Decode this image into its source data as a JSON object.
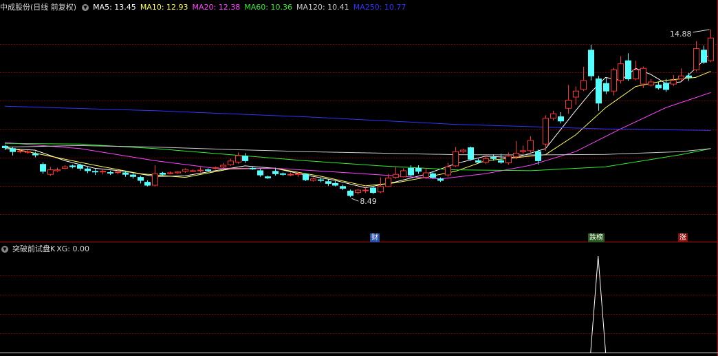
{
  "header": {
    "stock_title": "中成股份(日线 前复权)",
    "ma_items": [
      {
        "label": "MA5: 13.45",
        "color": "#ffffff"
      },
      {
        "label": "MA10: 12.93",
        "color": "#ffff55"
      },
      {
        "label": "MA20: 12.38",
        "color": "#ff44ff"
      },
      {
        "label": "MA60: 10.36",
        "color": "#33ee33"
      },
      {
        "label": "MA120: 10.41",
        "color": "#cccccc"
      },
      {
        "label": "MA250: 10.77",
        "color": "#3333ff"
      }
    ]
  },
  "indicator": {
    "title": "突破前试盘K",
    "value_label": "XG: 0.00"
  },
  "colors": {
    "up": "#ff3232",
    "down": "#54ffff",
    "grid": "#7a0000",
    "ma5": "#ffffff",
    "ma10": "#ffff55",
    "ma20": "#ff44ff",
    "ma60": "#33ee33",
    "ma120": "#cccccc",
    "ma250": "#3333ff"
  },
  "chart_data": {
    "type": "candlestick",
    "ylim": [
      7.9,
      15.4
    ],
    "max_label": "14.88",
    "min_label": "8.49",
    "candles": [
      [
        11.03,
        10.98,
        11.08,
        10.9
      ],
      [
        10.95,
        10.85,
        11.0,
        10.72
      ],
      [
        10.85,
        10.87,
        10.92,
        10.8
      ],
      [
        10.84,
        10.85,
        10.9,
        10.78
      ],
      [
        10.78,
        10.74,
        10.85,
        10.66
      ],
      [
        10.43,
        10.2,
        10.5,
        10.12
      ],
      [
        10.1,
        10.25,
        10.35,
        10.05
      ],
      [
        10.22,
        10.25,
        10.32,
        10.18
      ],
      [
        10.3,
        10.35,
        10.4,
        10.27
      ],
      [
        10.38,
        10.35,
        10.42,
        10.3
      ],
      [
        10.4,
        10.3,
        10.45,
        10.22
      ],
      [
        10.28,
        10.22,
        10.34,
        10.14
      ],
      [
        10.2,
        10.18,
        10.28,
        10.08
      ],
      [
        10.2,
        10.2,
        10.25,
        10.1
      ],
      [
        10.16,
        10.15,
        10.22,
        10.08
      ],
      [
        10.18,
        10.18,
        10.24,
        10.1
      ],
      [
        10.15,
        10.1,
        10.22,
        10.02
      ],
      [
        10.08,
        10.03,
        10.14,
        9.96
      ],
      [
        10.0,
        9.9,
        10.05,
        9.8
      ],
      [
        9.84,
        9.74,
        9.9,
        9.7
      ],
      [
        9.74,
        10.12,
        10.4,
        9.7
      ],
      [
        10.14,
        10.1,
        10.18,
        10.04
      ],
      [
        10.15,
        10.15,
        10.2,
        10.1
      ],
      [
        10.15,
        10.18,
        10.2,
        10.12
      ],
      [
        10.2,
        10.26,
        10.3,
        10.15
      ],
      [
        10.22,
        10.22,
        10.26,
        10.18
      ],
      [
        10.24,
        10.24,
        10.34,
        10.16
      ],
      [
        10.25,
        10.24,
        10.3,
        10.2
      ],
      [
        10.3,
        10.32,
        10.36,
        10.26
      ],
      [
        10.35,
        10.4,
        10.48,
        10.3
      ],
      [
        10.42,
        10.54,
        10.62,
        10.38
      ],
      [
        10.5,
        10.72,
        10.82,
        10.45
      ],
      [
        10.7,
        10.55,
        10.8,
        10.48
      ],
      [
        10.3,
        10.28,
        10.34,
        10.25
      ],
      [
        10.22,
        10.08,
        10.28,
        10.02
      ],
      [
        10.02,
        9.98,
        10.06,
        9.95
      ],
      [
        10.2,
        10.12,
        10.32,
        10.06
      ],
      [
        10.12,
        10.1,
        10.16,
        10.05
      ],
      [
        10.1,
        10.1,
        10.16,
        10.04
      ],
      [
        10.1,
        10.12,
        10.18,
        10.02
      ],
      [
        10.1,
        9.92,
        10.14,
        9.88
      ],
      [
        9.9,
        9.95,
        10.0,
        9.86
      ],
      [
        9.92,
        9.9,
        9.98,
        9.84
      ],
      [
        9.86,
        9.8,
        9.94,
        9.72
      ],
      [
        9.8,
        9.74,
        9.88,
        9.7
      ],
      [
        9.7,
        9.64,
        9.76,
        9.58
      ],
      [
        9.55,
        9.4,
        9.6,
        9.35
      ],
      [
        9.5,
        9.58,
        9.62,
        9.44
      ],
      [
        9.56,
        9.58,
        9.66,
        9.48
      ],
      [
        9.65,
        9.5,
        9.7,
        9.45
      ],
      [
        9.52,
        9.7,
        10.0,
        9.48
      ],
      [
        9.7,
        9.98,
        10.12,
        9.68
      ],
      [
        10.0,
        10.1,
        10.34,
        9.95
      ],
      [
        10.02,
        10.22,
        10.3,
        10.0
      ],
      [
        10.3,
        10.08,
        10.4,
        10.02
      ],
      [
        10.3,
        10.2,
        10.4,
        10.12
      ],
      [
        10.0,
        10.15,
        10.3,
        9.95
      ],
      [
        10.12,
        10.0,
        10.2,
        9.95
      ],
      [
        9.95,
        9.9,
        10.0,
        9.85
      ],
      [
        10.08,
        10.35,
        10.48,
        10.02
      ],
      [
        10.38,
        10.85,
        11.0,
        10.35
      ],
      [
        10.85,
        10.9,
        10.95,
        10.8
      ],
      [
        10.98,
        10.6,
        11.02,
        10.55
      ],
      [
        10.55,
        10.5,
        10.62,
        10.46
      ],
      [
        10.5,
        10.62,
        10.72,
        10.44
      ],
      [
        10.66,
        10.62,
        10.76,
        10.55
      ],
      [
        10.55,
        10.5,
        10.78,
        10.45
      ],
      [
        10.48,
        10.7,
        10.82,
        10.42
      ],
      [
        10.68,
        10.8,
        11.2,
        10.6
      ],
      [
        10.85,
        10.88,
        11.05,
        10.78
      ],
      [
        10.88,
        11.22,
        11.36,
        10.82
      ],
      [
        10.85,
        10.55,
        10.92,
        10.42
      ],
      [
        11.1,
        11.95,
        12.05,
        10.88
      ],
      [
        11.95,
        12.1,
        12.2,
        11.88
      ],
      [
        12.0,
        11.86,
        12.15,
        11.78
      ],
      [
        12.28,
        12.55,
        13.05,
        12.1
      ],
      [
        12.65,
        12.85,
        13.0,
        12.4
      ],
      [
        12.9,
        13.2,
        13.65,
        12.85
      ],
      [
        14.2,
        13.35,
        14.38,
        13.2
      ],
      [
        13.25,
        12.45,
        13.35,
        12.2
      ],
      [
        13.1,
        12.85,
        13.28,
        12.75
      ],
      [
        12.85,
        13.55,
        13.62,
        12.7
      ],
      [
        13.2,
        13.75,
        14.0,
        13.1
      ],
      [
        13.85,
        13.25,
        14.1,
        13.18
      ],
      [
        13.25,
        13.55,
        13.85,
        13.2
      ],
      [
        13.08,
        13.6,
        13.66,
        12.95
      ],
      [
        13.05,
        13.15,
        13.25,
        13.0
      ],
      [
        13.05,
        12.95,
        13.15,
        12.9
      ],
      [
        13.1,
        12.9,
        13.25,
        12.82
      ],
      [
        13.08,
        13.2,
        13.38,
        13.02
      ],
      [
        13.25,
        13.35,
        13.6,
        13.18
      ],
      [
        13.35,
        13.3,
        13.45,
        13.18
      ],
      [
        13.55,
        14.25,
        14.5,
        13.5
      ],
      [
        14.2,
        13.8,
        14.35,
        13.75
      ],
      [
        13.85,
        14.6,
        14.88,
        13.8
      ]
    ],
    "ma_lines": [
      {
        "name": "MA5",
        "color": "#ffffff",
        "points": [
          [
            0,
            10.95
          ],
          [
            4,
            10.9
          ],
          [
            8,
            10.55
          ],
          [
            12,
            10.3
          ],
          [
            16,
            10.2
          ],
          [
            20,
            10.03
          ],
          [
            24,
            10.05
          ],
          [
            28,
            10.22
          ],
          [
            32,
            10.38
          ],
          [
            36,
            10.3
          ],
          [
            40,
            10.08
          ],
          [
            44,
            9.9
          ],
          [
            48,
            9.66
          ],
          [
            52,
            9.85
          ],
          [
            56,
            10.1
          ],
          [
            60,
            10.45
          ],
          [
            64,
            10.7
          ],
          [
            68,
            10.65
          ],
          [
            72,
            10.95
          ],
          [
            76,
            12.2
          ],
          [
            78,
            12.8
          ],
          [
            80,
            13.3
          ],
          [
            82,
            13.2
          ],
          [
            84,
            13.6
          ],
          [
            86,
            13.4
          ],
          [
            88,
            13.1
          ],
          [
            90,
            13.15
          ],
          [
            92,
            13.6
          ],
          [
            94,
            14.1
          ]
        ]
      },
      {
        "name": "MA10",
        "color": "#ffff55",
        "points": [
          [
            0,
            11.0
          ],
          [
            6,
            10.7
          ],
          [
            12,
            10.4
          ],
          [
            18,
            10.12
          ],
          [
            24,
            10.0
          ],
          [
            30,
            10.28
          ],
          [
            36,
            10.3
          ],
          [
            42,
            10.04
          ],
          [
            48,
            9.72
          ],
          [
            52,
            9.82
          ],
          [
            56,
            10.0
          ],
          [
            60,
            10.2
          ],
          [
            64,
            10.55
          ],
          [
            68,
            10.65
          ],
          [
            72,
            10.75
          ],
          [
            76,
            11.4
          ],
          [
            80,
            12.3
          ],
          [
            84,
            13.0
          ],
          [
            88,
            13.2
          ],
          [
            92,
            13.3
          ],
          [
            94,
            13.5
          ]
        ]
      },
      {
        "name": "MA20",
        "color": "#ff44ff",
        "points": [
          [
            0,
            11.15
          ],
          [
            10,
            10.95
          ],
          [
            20,
            10.55
          ],
          [
            28,
            10.3
          ],
          [
            36,
            10.3
          ],
          [
            44,
            10.18
          ],
          [
            52,
            10.05
          ],
          [
            58,
            9.95
          ],
          [
            64,
            10.12
          ],
          [
            70,
            10.4
          ],
          [
            76,
            10.85
          ],
          [
            82,
            11.6
          ],
          [
            88,
            12.3
          ],
          [
            94,
            12.8
          ]
        ]
      },
      {
        "name": "MA60",
        "color": "#33ee33",
        "points": [
          [
            0,
            11.12
          ],
          [
            10,
            11.1
          ],
          [
            20,
            10.95
          ],
          [
            30,
            10.75
          ],
          [
            40,
            10.55
          ],
          [
            50,
            10.38
          ],
          [
            60,
            10.25
          ],
          [
            70,
            10.22
          ],
          [
            80,
            10.35
          ],
          [
            90,
            10.75
          ],
          [
            94,
            10.95
          ]
        ]
      },
      {
        "name": "MA120",
        "color": "#cccccc",
        "points": [
          [
            0,
            11.0
          ],
          [
            10,
            11.05
          ],
          [
            20,
            11.0
          ],
          [
            30,
            10.92
          ],
          [
            40,
            10.85
          ],
          [
            50,
            10.8
          ],
          [
            60,
            10.75
          ],
          [
            70,
            10.74
          ],
          [
            80,
            10.76
          ],
          [
            90,
            10.85
          ],
          [
            94,
            10.95
          ]
        ]
      },
      {
        "name": "MA250",
        "color": "#3333ff",
        "points": [
          [
            0,
            12.35
          ],
          [
            20,
            12.2
          ],
          [
            40,
            12.0
          ],
          [
            60,
            11.75
          ],
          [
            80,
            11.6
          ],
          [
            94,
            11.55
          ]
        ]
      }
    ],
    "event_markers": [
      {
        "index": 49,
        "label": "财",
        "bg": "#2a4ea8",
        "fg": "#ffffff"
      },
      {
        "index": 78,
        "label": "跌榜",
        "bg": "#2a5a20",
        "fg": "#ffffff"
      },
      {
        "index": 90,
        "label": "涨",
        "bg": "#8a1010",
        "fg": "#ffffff"
      }
    ],
    "indicator_series": {
      "name": "XG",
      "signal_index": 79,
      "value": 1,
      "ylim": [
        0,
        1
      ]
    }
  }
}
